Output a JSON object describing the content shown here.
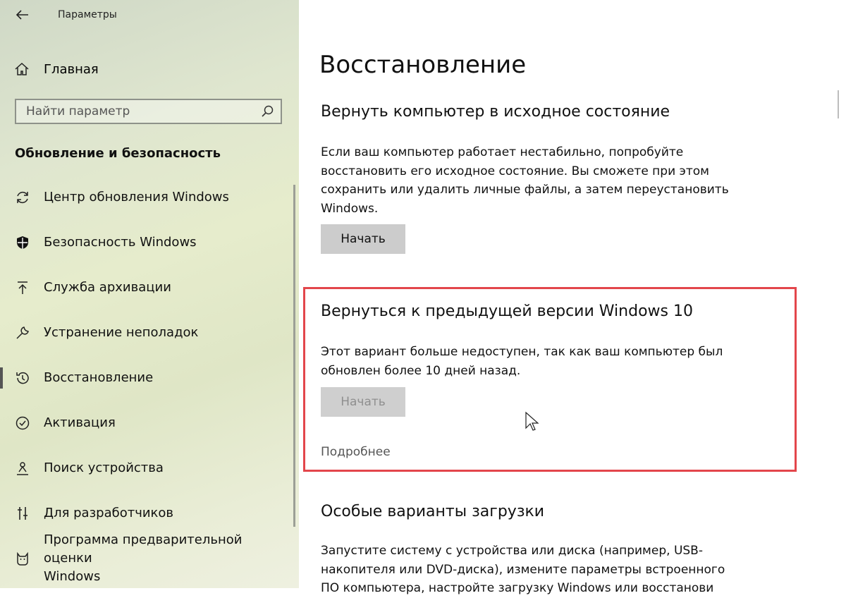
{
  "window": {
    "title": "Параметры"
  },
  "sidebar": {
    "home_label": "Главная",
    "search_placeholder": "Найти параметр",
    "section_title": "Обновление и безопасность",
    "items": [
      {
        "label": "Центр обновления Windows",
        "icon": "sync-icon"
      },
      {
        "label": "Безопасность Windows",
        "icon": "shield-icon"
      },
      {
        "label": "Служба архивации",
        "icon": "upload-arrow-icon"
      },
      {
        "label": "Устранение неполадок",
        "icon": "wrench-icon"
      },
      {
        "label": "Восстановление",
        "icon": "history-icon",
        "active": true
      },
      {
        "label": "Активация",
        "icon": "check-circle-icon"
      },
      {
        "label": "Поиск устройства",
        "icon": "person-location-icon"
      },
      {
        "label": "Для разработчиков",
        "icon": "developer-tools-icon"
      },
      {
        "label": "Программа предварительной оценки\nWindows",
        "icon": "cat-insider-icon"
      }
    ]
  },
  "main": {
    "page_title": "Восстановление",
    "reset": {
      "title": "Вернуть компьютер в исходное состояние",
      "description": "Если ваш компьютер работает нестабильно, попробуйте восстановить его исходное состояние. Вы сможете при этом сохранить или удалить личные файлы, а затем переустановить Windows.",
      "button": "Начать"
    },
    "rollback": {
      "title": "Вернуться к предыдущей версии Windows 10",
      "description": "Этот вариант больше недоступен, так как ваш компьютер был обновлен более 10 дней назад.",
      "button": "Начать",
      "link": "Подробнее"
    },
    "advanced": {
      "title": "Особые варианты загрузки",
      "description": "Запустите систему с устройства или диска (например, USB-накопителя или DVD-диска), измените параметры встроенного ПО компьютера, настройте загрузку Windows или восстанови"
    }
  },
  "colors": {
    "highlight_border": "#e3464b",
    "button_bg": "#cccccc"
  }
}
